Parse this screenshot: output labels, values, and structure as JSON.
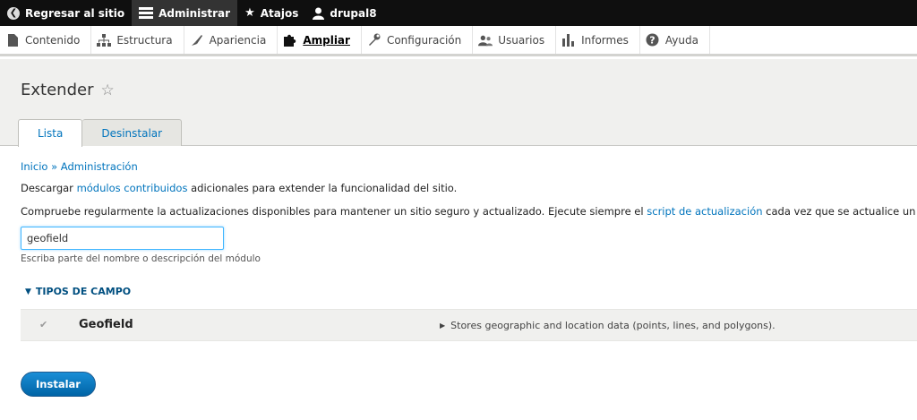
{
  "toolbar": {
    "items": [
      {
        "label": "Regresar al sitio",
        "icon": "back-circle-icon"
      },
      {
        "label": "Administrar",
        "icon": "hamburger-menu-icon"
      },
      {
        "label": "Atajos",
        "icon": "star-icon"
      },
      {
        "label": "drupal8",
        "icon": "user-icon"
      }
    ]
  },
  "tray": {
    "items": [
      {
        "label": "Contenido",
        "icon": "file-icon"
      },
      {
        "label": "Estructura",
        "icon": "sitemap-icon"
      },
      {
        "label": "Apariencia",
        "icon": "paintbrush-icon"
      },
      {
        "label": "Ampliar",
        "icon": "puzzle-icon"
      },
      {
        "label": "Configuración",
        "icon": "wrench-icon"
      },
      {
        "label": "Usuarios",
        "icon": "users-icon"
      },
      {
        "label": "Informes",
        "icon": "bar-chart-icon"
      },
      {
        "label": "Ayuda",
        "icon": "help-icon"
      }
    ]
  },
  "page": {
    "title": "Extender",
    "tabs": [
      "Lista",
      "Desinstalar"
    ]
  },
  "breadcrumb": {
    "home": "Inicio",
    "sep": "»",
    "admin": "Administración"
  },
  "intro": {
    "p1_before": "Descargar ",
    "p1_link": "módulos contribuidos",
    "p1_after": " adicionales para extender la funcionalidad del sitio.",
    "p2_before": "Compruebe regularmente la actualizaciones disponibles para mantener un sitio seguro y actualizado. Ejecute siempre el ",
    "p2_link": "script de actualización",
    "p2_after": " cada vez que se actualice un módulo."
  },
  "filter": {
    "value": "geofield",
    "description": "Escriba parte del nombre o descripción del módulo"
  },
  "group": {
    "title": "TIPOS DE CAMPO"
  },
  "module": {
    "name": "Geofield",
    "description": "Stores geographic and location data (points, lines, and polygons).",
    "checked": true
  },
  "actions": {
    "install_label": "Instalar"
  },
  "colors": {
    "toolbar_bg": "#0f0f0f",
    "link": "#0074bd",
    "button": "#0071b8"
  }
}
